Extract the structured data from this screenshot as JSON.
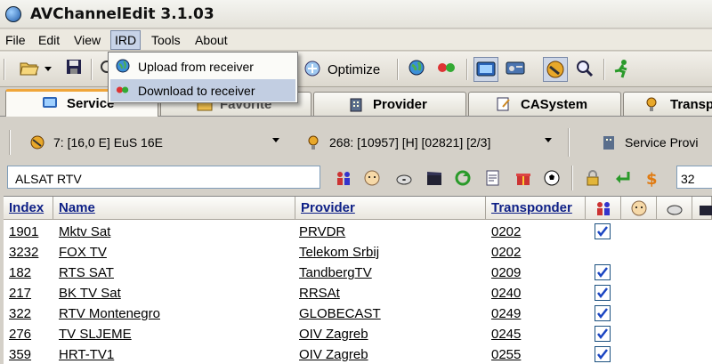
{
  "window": {
    "title": "AVChannelEdit 3.1.03"
  },
  "menu": {
    "items": [
      "File",
      "Edit",
      "View",
      "IRD",
      "Tools",
      "About"
    ],
    "active": "IRD"
  },
  "toolbar": {
    "optimize_label": "Optimize"
  },
  "ird_menu": {
    "items": [
      {
        "label": "Upload from receiver",
        "highlighted": false
      },
      {
        "label": "Download to receiver",
        "highlighted": true
      }
    ]
  },
  "tabs": [
    {
      "label": "Service",
      "active": true
    },
    {
      "label": "Favorite",
      "active": false
    },
    {
      "label": "Provider",
      "active": false
    },
    {
      "label": "CASystem",
      "active": false
    },
    {
      "label": "Transp",
      "active": false
    }
  ],
  "satellite_combo": {
    "value": "7: [16,0 E] EuS 16E"
  },
  "transponder_combo": {
    "value": "268: [10957] [H] [02821] [2/3]"
  },
  "service_provider_button": {
    "label": "Service Provi"
  },
  "filter": {
    "name_value": "ALSAT RTV",
    "number_value": "32"
  },
  "table": {
    "columns": [
      "Index",
      "Name",
      "Provider",
      "Transponder"
    ],
    "rows": [
      {
        "index": "1901",
        "name": "Mktv Sat",
        "provider": "PRVDR",
        "transponder": "0202",
        "checked": true
      },
      {
        "index": "3232",
        "name": "FOX TV",
        "provider": "Telekom Srbij",
        "transponder": "0202",
        "checked": false
      },
      {
        "index": "182",
        "name": "RTS SAT",
        "provider": "TandbergTV",
        "transponder": "0209",
        "checked": true
      },
      {
        "index": "217",
        "name": "BK TV Sat",
        "provider": "RRSAt",
        "transponder": "0240",
        "checked": true
      },
      {
        "index": "322",
        "name": "RTV Montenegro",
        "provider": "GLOBECAST",
        "transponder": "0249",
        "checked": true
      },
      {
        "index": "276",
        "name": "TV SLJEME",
        "provider": "OIV Zagreb",
        "transponder": "0245",
        "checked": true
      },
      {
        "index": "359",
        "name": "HRT-TV1",
        "provider": "OIV Zagreb",
        "transponder": "0255",
        "checked": true
      }
    ]
  }
}
